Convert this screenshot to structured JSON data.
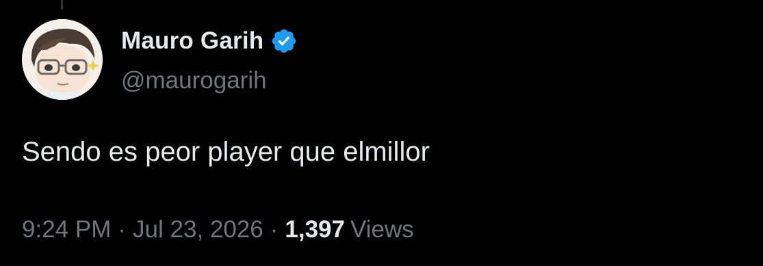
{
  "author": {
    "display_name": "Mauro Garih",
    "handle": "@maurogarih",
    "verified_icon": "verified-badge-icon",
    "badge_color": "#1d9bf0"
  },
  "tweet": {
    "text": "Sendo es peor player que elmillor",
    "time": "9:24 PM",
    "separator": "·",
    "date": "Jul 23, 2026",
    "views_count": "1,397",
    "views_label": "Views"
  },
  "colors": {
    "background": "#000000",
    "primary_text": "#e7e9ea",
    "secondary_text": "#71767b"
  }
}
